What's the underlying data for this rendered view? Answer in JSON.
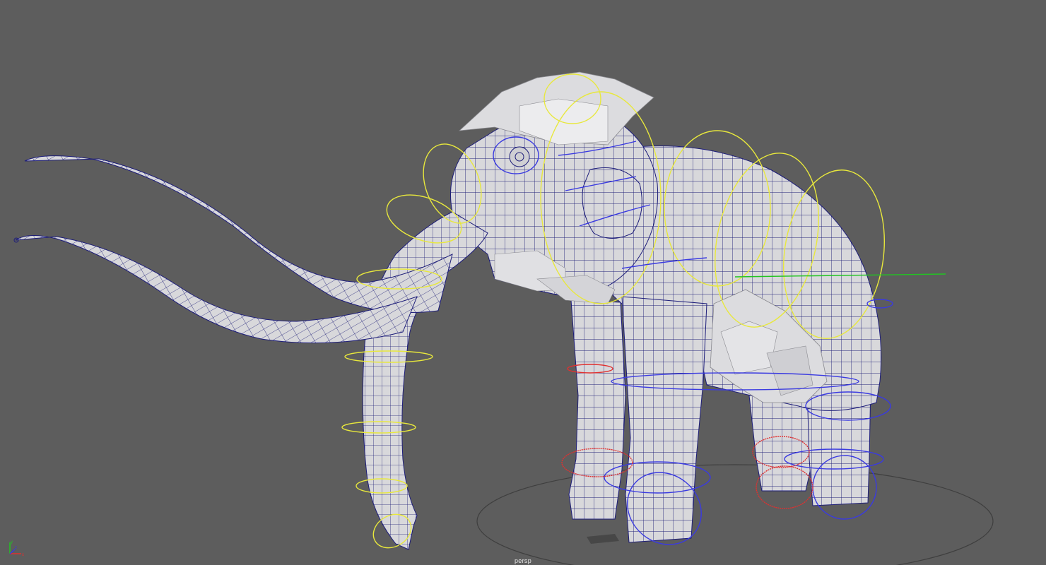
{
  "viewport": {
    "camera_label": "persp",
    "background_color": "#5d5d5d",
    "mesh_color": "#d9d9dc",
    "wire_color": "#1d1d7a",
    "control_colors": {
      "yellow": "#e8e83c",
      "blue": "#3a3ae0",
      "red": "#e03030",
      "green": "#22c422"
    }
  },
  "axis_indicator": {
    "x_label": "x",
    "y_label": "y",
    "z_label": "z"
  }
}
